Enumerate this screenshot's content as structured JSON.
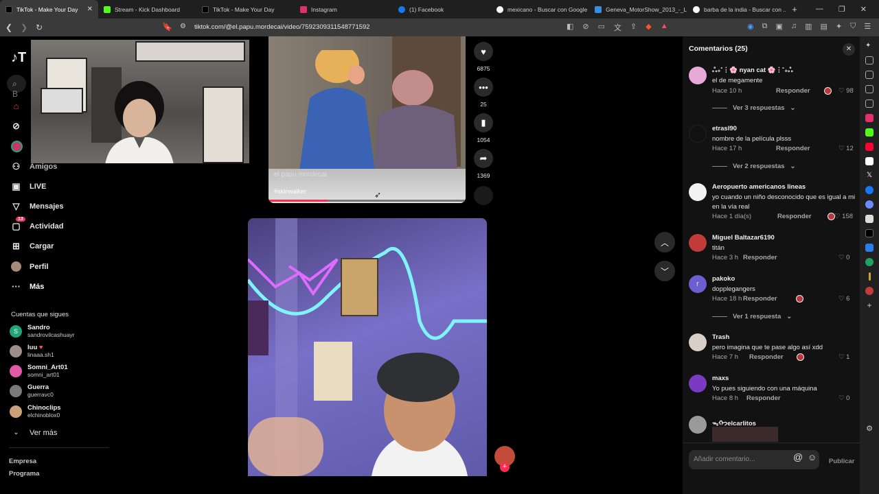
{
  "browser": {
    "tabs": [
      {
        "title": "TikTok - Make Your Day",
        "active": true,
        "color": "#000000"
      },
      {
        "title": "Stream - Kick Dashboard",
        "active": false,
        "color": "#53fc18"
      },
      {
        "title": "TikTok - Make Your Day",
        "active": false,
        "color": "#000000"
      },
      {
        "title": "Instagram",
        "active": false,
        "color": "#e1306c"
      },
      {
        "title": "(1) Facebook",
        "active": false,
        "color": "#1877f2"
      },
      {
        "title": "mexicano - Buscar con Google",
        "active": false,
        "color": "#ffffff"
      },
      {
        "title": "Geneva_MotorShow_2013_-_L...",
        "active": false,
        "color": "#3a8dde"
      },
      {
        "title": "barba de la india - Buscar con ...",
        "active": false,
        "color": "#ffffff"
      }
    ],
    "url": "tiktok.com/@el.papu.mordecai/video/7592309311548771592"
  },
  "sidebar": {
    "search_placeholder": "B",
    "items": [
      {
        "label": "Amigos",
        "icon": "friends-icon"
      },
      {
        "label": "LIVE",
        "icon": "live-icon"
      },
      {
        "label": "Mensajes",
        "icon": "messages-icon"
      },
      {
        "label": "Actividad",
        "icon": "activity-icon",
        "badge": "13"
      },
      {
        "label": "Cargar",
        "icon": "upload-icon"
      },
      {
        "label": "Perfil",
        "icon": "profile-icon"
      },
      {
        "label": "Más",
        "icon": "more-icon"
      }
    ],
    "following_title": "Cuentas que sigues",
    "following": [
      {
        "name": "Sandro",
        "handle": "sandrovilcashuayr",
        "color": "#1fa67a"
      },
      {
        "name": "luu",
        "handle": "linaaa.sh1",
        "color": "#9a8e86"
      },
      {
        "name": "Somni_Art01",
        "handle": "somni_art01",
        "color": "#e05aa8"
      },
      {
        "name": "Guerra",
        "handle": "guerravc0",
        "color": "#7a7a7a"
      },
      {
        "name": "Chinoclips",
        "handle": "elchinoblox0",
        "color": "#c9a27a"
      }
    ],
    "see_more": "Ver más",
    "footer": [
      "Empresa",
      "Programa"
    ]
  },
  "video1": {
    "overlay_title": "el papu mordecai",
    "hashtag": "#skinwalker",
    "progress": 0.3
  },
  "actions": {
    "likes": "6875",
    "comments": "25",
    "saves": "1054",
    "shares": "1369"
  },
  "comments": {
    "title": "Comentarios (25)",
    "reply_label": "Responder",
    "items": [
      {
        "user": "ஃ₊˚⋮🌸 nyan cat 🌸⋮˚₊ஃ",
        "text": "el de megamente",
        "time": "Hace 10 h",
        "likes": "98",
        "creator_liked": true,
        "replies": "Ver 3 respuestas",
        "color": "#e6a9d8"
      },
      {
        "user": "etrasl90",
        "text": "nombre de la película plsss",
        "time": "Hace 17 h",
        "likes": "12",
        "creator_liked": false,
        "replies": "Ver 2 respuestas",
        "color": "#111111"
      },
      {
        "user": "Aeropuerto americanos lineas",
        "text": "yo cuando un niño desconocido que es igual a mi en la vía real",
        "time": "Hace 1 día(s)",
        "likes": "158",
        "creator_liked": true,
        "replies": "",
        "color": "#f2f2f2"
      },
      {
        "user": "Miguel Baltazar6190",
        "text": "titán",
        "time": "Hace 3 h",
        "likes": "0",
        "creator_liked": false,
        "replies": "",
        "color": "#c23a3a"
      },
      {
        "user": "pakoko",
        "text": "dopplegangers",
        "time": "Hace 18 h",
        "likes": "6",
        "creator_liked": true,
        "replies": "Ver 1 respuesta",
        "color": "#6b5fd0"
      },
      {
        "user": "Trash",
        "text": "pero imagina que te pase algo así xdd",
        "time": "Hace 7 h",
        "likes": "1",
        "creator_liked": true,
        "replies": "",
        "color": "#d9cfc7"
      },
      {
        "user": "maxs",
        "text": "Yo pues siguiendo con una máquina",
        "time": "Hace 8 h",
        "likes": "0",
        "creator_liked": false,
        "replies": "",
        "color": "#7b3ac2"
      },
      {
        "user": "ᯓᡣ𐭩elcarlitos",
        "text": "",
        "time": "",
        "likes": "",
        "creator_liked": false,
        "replies": "",
        "color": "#9a9a9a"
      }
    ],
    "input_placeholder": "Añadir comentario...",
    "publish_label": "Publicar"
  }
}
